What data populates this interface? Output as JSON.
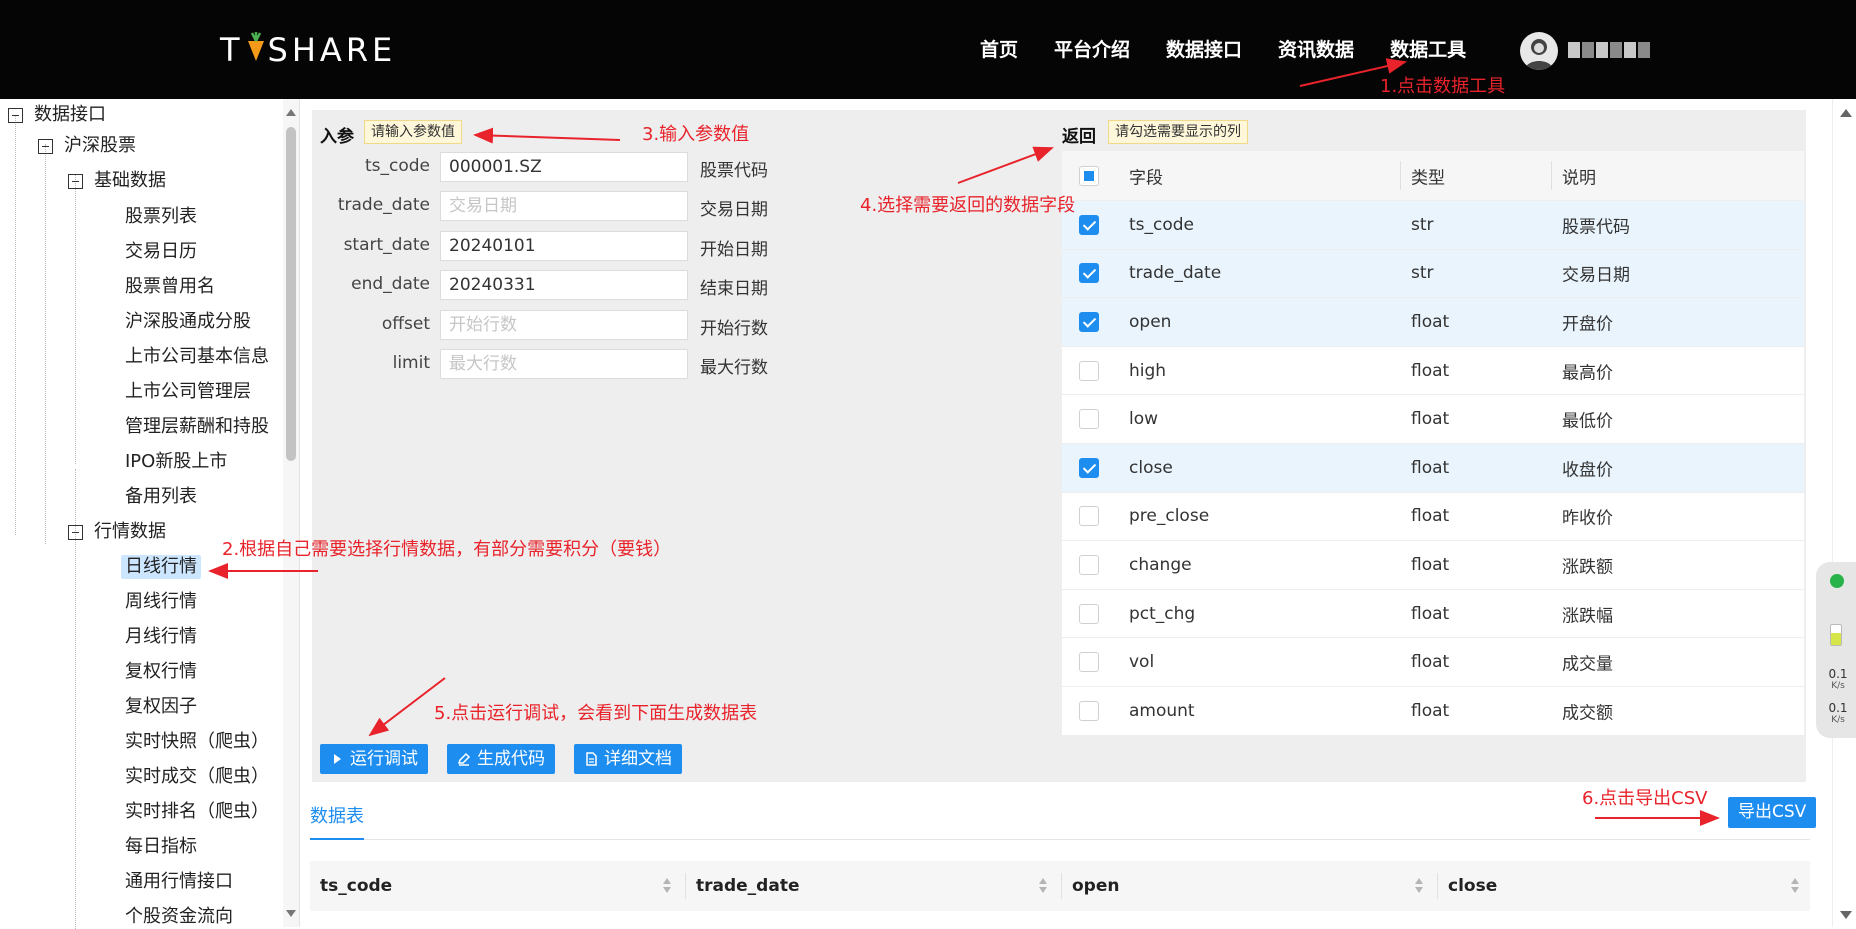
{
  "header": {
    "logo_text": "T SHARE",
    "nav": [
      "首页",
      "平台介绍",
      "数据接口",
      "资讯数据",
      "数据工具"
    ]
  },
  "tree": {
    "root": "数据接口",
    "level1": "沪深股票",
    "group1": "基础数据",
    "group1_items": [
      "股票列表",
      "交易日历",
      "股票曾用名",
      "沪深股通成分股",
      "上市公司基本信息",
      "上市公司管理层",
      "管理层薪酬和持股",
      "IPO新股上市",
      "备用列表"
    ],
    "group2": "行情数据",
    "group2_items": [
      "日线行情",
      "周线行情",
      "月线行情",
      "复权行情",
      "复权因子",
      "实时快照（爬虫）",
      "实时成交（爬虫）",
      "实时排名（爬虫）",
      "每日指标",
      "通用行情接口",
      "个股资金流向"
    ],
    "selected": "日线行情"
  },
  "params": {
    "title": "入参",
    "tip": "请输入参数值",
    "rows": [
      {
        "name": "ts_code",
        "value": "000001.SZ",
        "placeholder": "",
        "desc": "股票代码"
      },
      {
        "name": "trade_date",
        "value": "",
        "placeholder": "交易日期",
        "desc": "交易日期"
      },
      {
        "name": "start_date",
        "value": "20240101",
        "placeholder": "",
        "desc": "开始日期"
      },
      {
        "name": "end_date",
        "value": "20240331",
        "placeholder": "",
        "desc": "结束日期"
      },
      {
        "name": "offset",
        "value": "",
        "placeholder": "开始行数",
        "desc": "开始行数"
      },
      {
        "name": "limit",
        "value": "",
        "placeholder": "最大行数",
        "desc": "最大行数"
      }
    ]
  },
  "returns": {
    "title": "返回",
    "tip": "请勾选需要显示的列",
    "headers": [
      "字段",
      "类型",
      "说明"
    ],
    "rows": [
      {
        "field": "ts_code",
        "type": "str",
        "desc": "股票代码",
        "checked": true
      },
      {
        "field": "trade_date",
        "type": "str",
        "desc": "交易日期",
        "checked": true
      },
      {
        "field": "open",
        "type": "float",
        "desc": "开盘价",
        "checked": true
      },
      {
        "field": "high",
        "type": "float",
        "desc": "最高价",
        "checked": false
      },
      {
        "field": "low",
        "type": "float",
        "desc": "最低价",
        "checked": false
      },
      {
        "field": "close",
        "type": "float",
        "desc": "收盘价",
        "checked": true
      },
      {
        "field": "pre_close",
        "type": "float",
        "desc": "昨收价",
        "checked": false
      },
      {
        "field": "change",
        "type": "float",
        "desc": "涨跌额",
        "checked": false
      },
      {
        "field": "pct_chg",
        "type": "float",
        "desc": "涨跌幅",
        "checked": false
      },
      {
        "field": "vol",
        "type": "float",
        "desc": "成交量",
        "checked": false
      },
      {
        "field": "amount",
        "type": "float",
        "desc": "成交额",
        "checked": false
      }
    ]
  },
  "buttons": {
    "run": "运行调试",
    "gen": "生成代码",
    "doc": "详细文档",
    "export": "导出CSV"
  },
  "datatable": {
    "tab": "数据表",
    "columns": [
      "ts_code",
      "trade_date",
      "open",
      "close"
    ]
  },
  "widget": {
    "up": "0.1",
    "down": "0.1",
    "unit": "K/s"
  },
  "annotations": {
    "a1": "1.点击数据工具",
    "a2": "2.根据自己需要选择行情数据，有部分需要积分（要钱）",
    "a3": "3.输入参数值",
    "a4": "4.选择需要返回的数据字段",
    "a5": "5.点击运行调试，会看到下面生成数据表",
    "a6": "6.点击导出CSV"
  },
  "colors": {
    "accent": "#1e8df0",
    "annotation": "#e8232b",
    "header_bg": "#050505"
  }
}
